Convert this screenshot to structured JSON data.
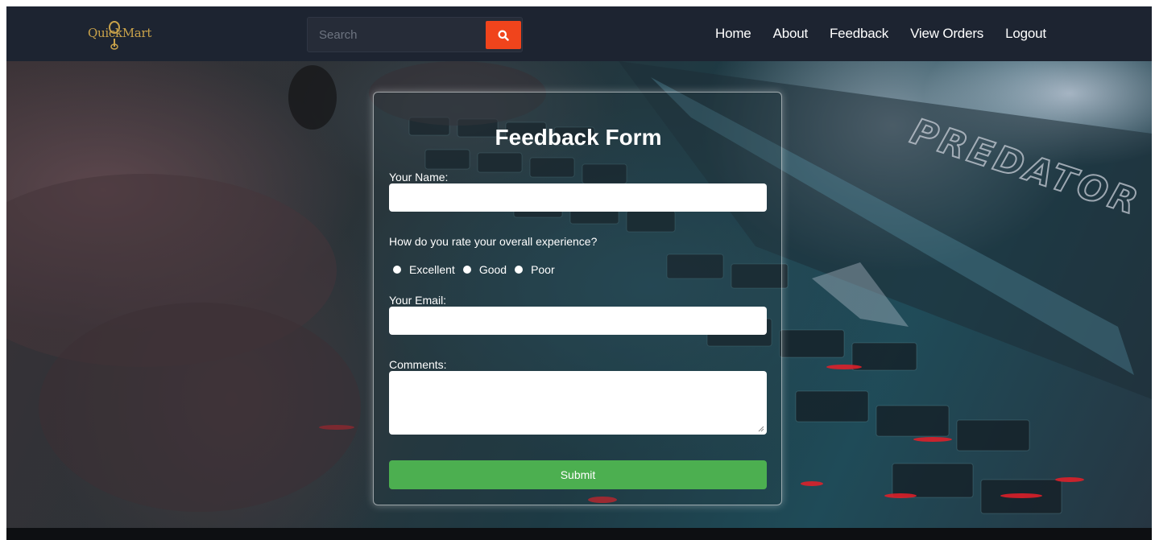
{
  "header": {
    "logo_text": "QuickMart",
    "search": {
      "placeholder": "Search"
    },
    "nav": [
      "Home",
      "About",
      "Feedback",
      "View Orders",
      "Logout"
    ]
  },
  "hero": {
    "overlay_text": "PREDATOR"
  },
  "form": {
    "title": "Feedback Form",
    "name_label": "Your Name:",
    "rating_question": "How do you rate your overall experience?",
    "rating_options": [
      "Excellent",
      "Good",
      "Poor"
    ],
    "email_label": "Your Email:",
    "comments_label": "Comments:",
    "submit_label": "Submit"
  },
  "colors": {
    "navbar": "#1d2431",
    "search_button": "#f0441c",
    "submit_button": "#4caf50",
    "logo": "#c9a24a"
  }
}
